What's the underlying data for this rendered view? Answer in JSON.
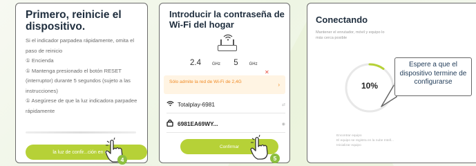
{
  "colors": {
    "accent_green": "#b6d137",
    "badge_green": "#8cbf3f",
    "warning_orange": "#f08a24",
    "title_navy": "#1e2d3d"
  },
  "screen1": {
    "title": "Primero, reinicie el dispositivo.",
    "instructions": [
      "Si el indicador parpadea rápidamente, omita el paso de reinicio",
      "① Encienda",
      "① Mantenga presionado el botón RESET (interruptor) durante 5 segundos (sujeto a las instrucciones)",
      "① Asegúrese de que la luz indicadora parpadee rápidamente"
    ],
    "button_label": "la luz de confir...ción en el flash",
    "step_number": "4"
  },
  "screen2": {
    "title": "Introducir la contraseña de Wi-Fi del hogar",
    "band_24": "2.4",
    "band_5": "5",
    "band_unit": "GHz",
    "band_5_unsupported_mark": "✕",
    "warning_text": "Sólo admite la red de Wi-Fi de 2,4G",
    "network_name": "Totalplay-6981",
    "password_value": "6981EA69WY...",
    "confirm_label": "Confirmar",
    "step_number": "5",
    "icons": [
      "router-icon",
      "wifi-icon",
      "lock-icon",
      "eye-icon",
      "swap-icon",
      "chevron-right-icon"
    ]
  },
  "screen3": {
    "title": "Conectando",
    "subtitle": "Mantener el enrutador, móvil y equipo lo más cerca posible",
    "progress_label": "10%",
    "progress": 0.1,
    "steps": [
      "Encontrar equipo",
      "El equipo se registra en la nube Intell...",
      "Inicializar equipo"
    ]
  },
  "callout": {
    "text": "Espere a que el dispositivo termine de configurarse"
  }
}
